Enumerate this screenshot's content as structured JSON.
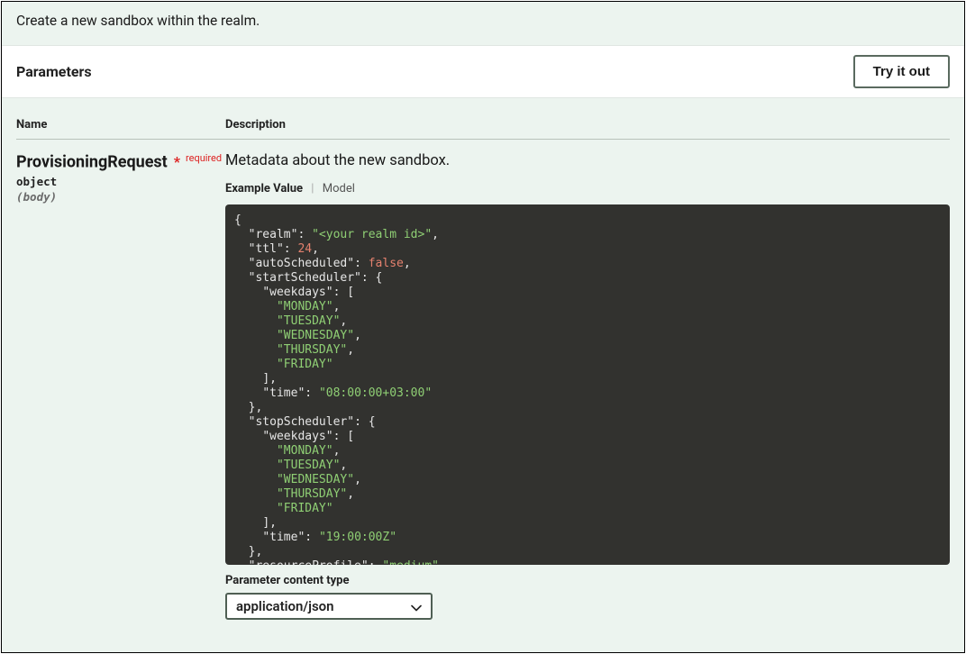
{
  "intro_text": "Create a new sandbox within the realm.",
  "params_header": "Parameters",
  "try_button": "Try it out",
  "columns": {
    "name": "Name",
    "description": "Description"
  },
  "param": {
    "name": "ProvisioningRequest",
    "required_star": "*",
    "required_text": "required",
    "type": "object",
    "in": "(body)",
    "description": "Metadata about the new sandbox."
  },
  "tabs": {
    "example": "Example Value",
    "model": "Model"
  },
  "example_json": {
    "realm": "<your realm id>",
    "ttl": 24,
    "autoScheduled": false,
    "startScheduler": {
      "weekdays": [
        "MONDAY",
        "TUESDAY",
        "WEDNESDAY",
        "THURSDAY",
        "FRIDAY"
      ],
      "time": "08:00:00+03:00"
    },
    "stopScheduler": {
      "weekdays": [
        "MONDAY",
        "TUESDAY",
        "WEDNESDAY",
        "THURSDAY",
        "FRIDAY"
      ],
      "time": "19:00:00Z"
    },
    "resourceProfile": "medium"
  },
  "content_type": {
    "label": "Parameter content type",
    "selected": "application/json"
  }
}
